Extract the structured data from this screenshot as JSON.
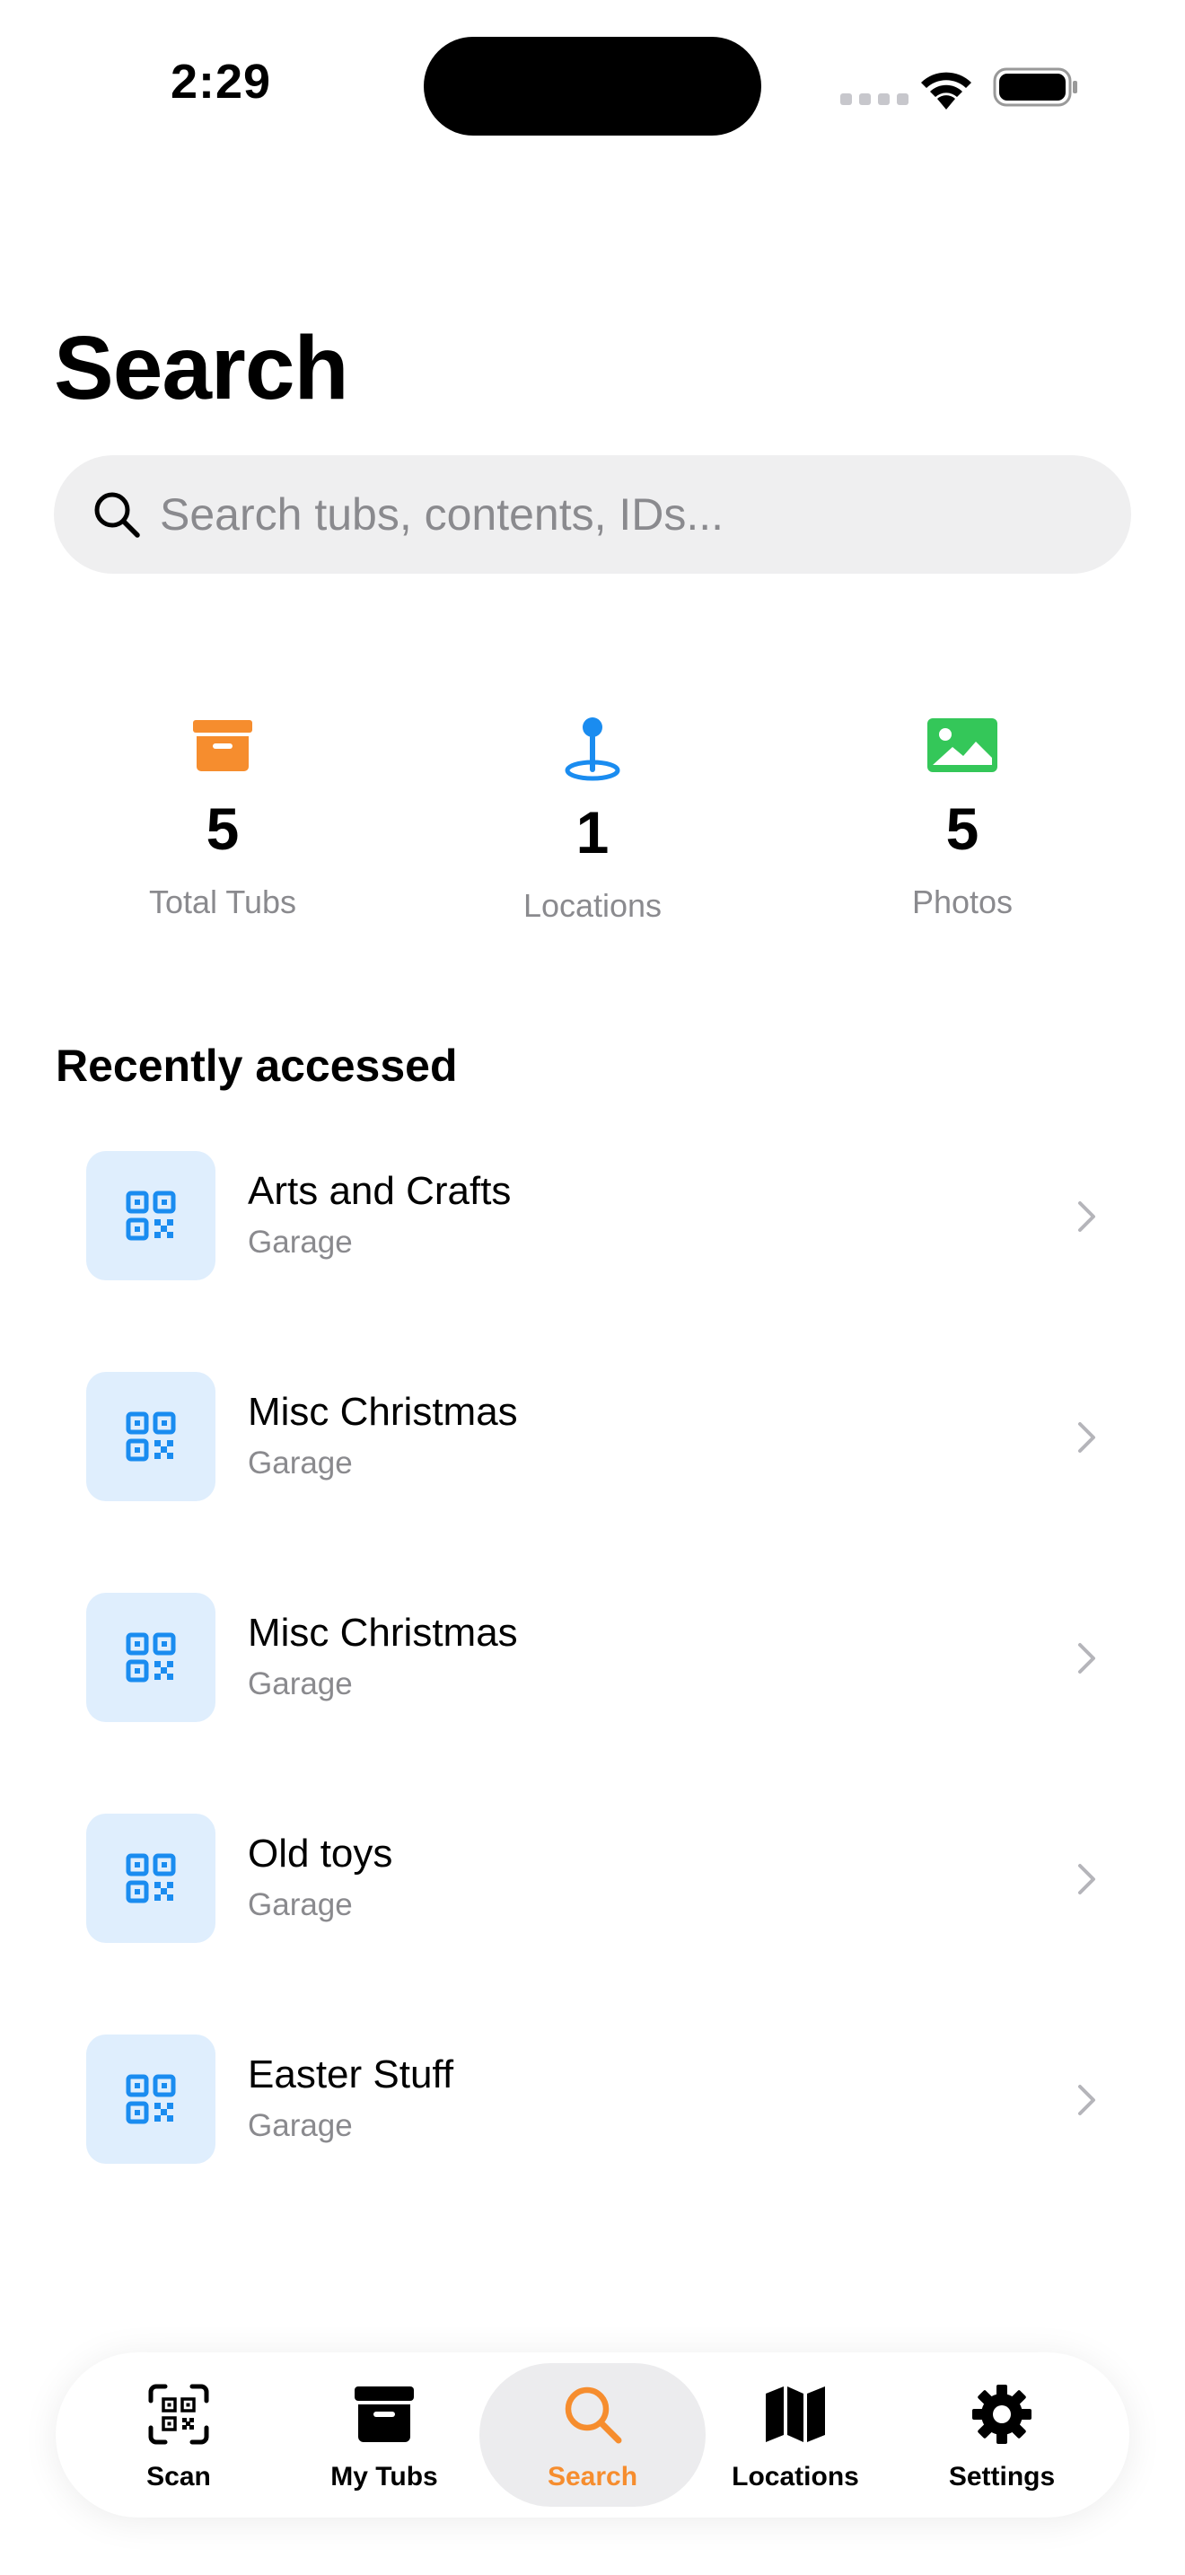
{
  "status_bar": {
    "time": "2:29"
  },
  "page": {
    "title": "Search"
  },
  "search": {
    "placeholder": "Search tubs, contents, IDs...",
    "value": ""
  },
  "stats": [
    {
      "icon": "archive-box-icon",
      "value": "5",
      "label": "Total Tubs",
      "color": "#f68d2e"
    },
    {
      "icon": "map-pin-icon",
      "value": "1",
      "label": "Locations",
      "color": "#1a8cf0"
    },
    {
      "icon": "photo-icon",
      "value": "5",
      "label": "Photos",
      "color": "#34c759"
    }
  ],
  "recent": {
    "title": "Recently accessed",
    "items": [
      {
        "title": "Arts and Crafts",
        "subtitle": "Garage"
      },
      {
        "title": "Misc Christmas",
        "subtitle": "Garage"
      },
      {
        "title": "Misc Christmas",
        "subtitle": "Garage"
      },
      {
        "title": "Old toys",
        "subtitle": "Garage"
      },
      {
        "title": "Easter Stuff",
        "subtitle": "Garage"
      }
    ]
  },
  "tab_bar": {
    "tabs": [
      {
        "label": "Scan",
        "icon": "qr-scan-icon",
        "active": false
      },
      {
        "label": "My Tubs",
        "icon": "archive-box-icon",
        "active": false
      },
      {
        "label": "Search",
        "icon": "search-icon",
        "active": true
      },
      {
        "label": "Locations",
        "icon": "map-icon",
        "active": false
      },
      {
        "label": "Settings",
        "icon": "gear-icon",
        "active": false
      }
    ]
  },
  "colors": {
    "accent": "#f68d2e",
    "blue": "#1a8cf0",
    "green": "#34c759",
    "secondary_text": "#8a8a8e",
    "thumb_background": "#dfeefd",
    "search_background": "#efeff0"
  }
}
